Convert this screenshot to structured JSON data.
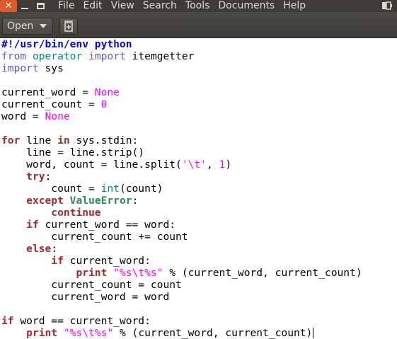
{
  "menubar": {
    "items": [
      "File",
      "Edit",
      "View",
      "Search",
      "Tools",
      "Documents",
      "Help"
    ],
    "icons": {
      "close": "close-icon",
      "minimize": "minimize-icon",
      "maximize": "maximize-icon",
      "tray": "battery-icon"
    }
  },
  "toolbar": {
    "open_label": "Open",
    "open_icon": "chevron-down-icon",
    "newdoc_icon": "new-document-icon"
  },
  "editor": {
    "lines": [
      [
        {
          "t": "#!/usr/bin/env python",
          "c": "pre"
        }
      ],
      [
        {
          "t": "from",
          "c": "mod"
        },
        {
          "t": " ",
          "c": "text"
        },
        {
          "t": "operator",
          "c": "builtin"
        },
        {
          "t": " ",
          "c": "text"
        },
        {
          "t": "import",
          "c": "mod"
        },
        {
          "t": " itemgetter",
          "c": "text"
        }
      ],
      [
        {
          "t": "import",
          "c": "mod"
        },
        {
          "t": " sys",
          "c": "text"
        }
      ],
      [
        {
          "t": "",
          "c": "text"
        }
      ],
      [
        {
          "t": "current_word = ",
          "c": "text"
        },
        {
          "t": "None",
          "c": "const"
        }
      ],
      [
        {
          "t": "current_count = ",
          "c": "text"
        },
        {
          "t": "0",
          "c": "const"
        }
      ],
      [
        {
          "t": "word = ",
          "c": "text"
        },
        {
          "t": "None",
          "c": "const"
        }
      ],
      [
        {
          "t": "",
          "c": "text"
        }
      ],
      [
        {
          "t": "for",
          "c": "kw"
        },
        {
          "t": " line ",
          "c": "text"
        },
        {
          "t": "in",
          "c": "kw"
        },
        {
          "t": " sys.stdin:",
          "c": "text"
        }
      ],
      [
        {
          "t": "    line = line.strip()",
          "c": "text"
        }
      ],
      [
        {
          "t": "    word, count = line.split(",
          "c": "text"
        },
        {
          "t": "'\\t'",
          "c": "str"
        },
        {
          "t": ", ",
          "c": "text"
        },
        {
          "t": "1",
          "c": "const"
        },
        {
          "t": ")",
          "c": "text"
        }
      ],
      [
        {
          "t": "    ",
          "c": "text"
        },
        {
          "t": "try",
          "c": "kw"
        },
        {
          "t": ":",
          "c": "text"
        }
      ],
      [
        {
          "t": "        count = ",
          "c": "text"
        },
        {
          "t": "int",
          "c": "builtin"
        },
        {
          "t": "(count)",
          "c": "text"
        }
      ],
      [
        {
          "t": "    ",
          "c": "text"
        },
        {
          "t": "except",
          "c": "kw"
        },
        {
          "t": " ",
          "c": "text"
        },
        {
          "t": "ValueError",
          "c": "exc"
        },
        {
          "t": ":",
          "c": "text"
        }
      ],
      [
        {
          "t": "        ",
          "c": "text"
        },
        {
          "t": "continue",
          "c": "kw"
        }
      ],
      [
        {
          "t": "    ",
          "c": "text"
        },
        {
          "t": "if",
          "c": "kw"
        },
        {
          "t": " current_word == word:",
          "c": "text"
        }
      ],
      [
        {
          "t": "        current_count += count",
          "c": "text"
        }
      ],
      [
        {
          "t": "    ",
          "c": "text"
        },
        {
          "t": "else",
          "c": "kw"
        },
        {
          "t": ":",
          "c": "text"
        }
      ],
      [
        {
          "t": "        ",
          "c": "text"
        },
        {
          "t": "if",
          "c": "kw"
        },
        {
          "t": " current_word:",
          "c": "text"
        }
      ],
      [
        {
          "t": "            ",
          "c": "text"
        },
        {
          "t": "print",
          "c": "kw"
        },
        {
          "t": " ",
          "c": "text"
        },
        {
          "t": "\"%s\\t%s\"",
          "c": "str"
        },
        {
          "t": " % (current_word, current_count)",
          "c": "text"
        }
      ],
      [
        {
          "t": "        current_count = count",
          "c": "text"
        }
      ],
      [
        {
          "t": "        current_word = word",
          "c": "text"
        }
      ],
      [
        {
          "t": "",
          "c": "text"
        }
      ],
      [
        {
          "t": "if",
          "c": "kw"
        },
        {
          "t": " word == current_word:",
          "c": "text"
        }
      ],
      [
        {
          "t": "    ",
          "c": "text"
        },
        {
          "t": "print",
          "c": "kw"
        },
        {
          "t": " ",
          "c": "text"
        },
        {
          "t": "\"%s\\t%s\"",
          "c": "str"
        },
        {
          "t": " % (current_word, current_count)",
          "c": "text"
        }
      ]
    ]
  }
}
